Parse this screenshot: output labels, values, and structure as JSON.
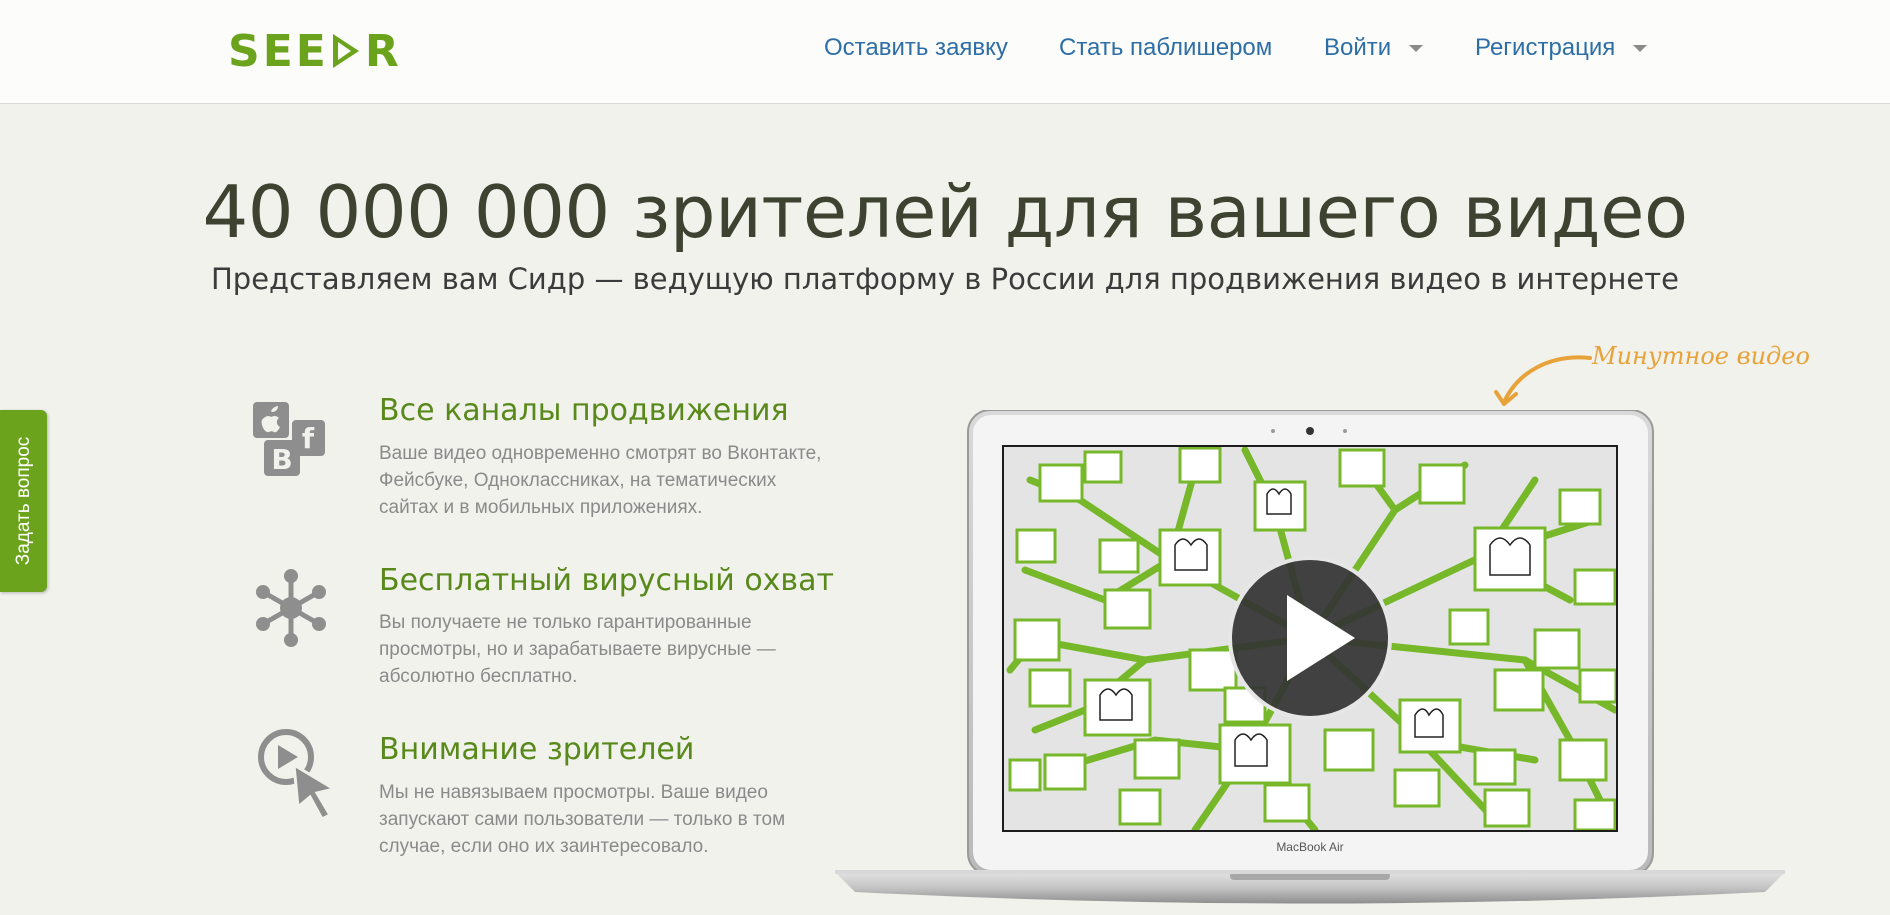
{
  "header": {
    "logo": {
      "before": "SEE",
      "after": "R"
    },
    "nav": [
      {
        "label": "Оставить заявку"
      },
      {
        "label": "Стать паблишером"
      },
      {
        "label": "Войти"
      },
      {
        "label": "Регистрация"
      }
    ]
  },
  "hero": {
    "headline": "40 000 000 зрителей для вашего видео",
    "subline": "Представляем вам Сидр — ведущую платформу в России для продвижения видео в интернете"
  },
  "side_tab": {
    "label": "Задать вопрос"
  },
  "features": [
    {
      "title": "Все каналы продвижения",
      "text": "Ваше видео одновременно смотрят во Вконтакте, Фейсбуке, Одноклассниках, на тематических сайтах и в мобильных приложениях.",
      "icon": "social-channels-icon",
      "icon_letters": {
        "vk": "B",
        "fb": "f"
      }
    },
    {
      "title": "Бесплатный вирусный охват",
      "text": "Вы получаете не только гарантированные просмотры, но и зарабатываете вирусные — абсолютно бесплатно.",
      "icon": "network-icon"
    },
    {
      "title": "Внимание зрителей",
      "text": "Мы не навязываем просмотры. Ваше видео запускают сами пользователи — только в том случае, если оно их заинтересовало.",
      "icon": "play-cursor-icon"
    }
  ],
  "video": {
    "note": "Минутное видео",
    "device_label": "MacBook Air"
  },
  "colors": {
    "brand_green": "#6ba41c",
    "feature_title": "#58891a",
    "nav_link": "#2e6ea6",
    "note_orange": "#e8a23a",
    "background": "#f2f2ed"
  }
}
